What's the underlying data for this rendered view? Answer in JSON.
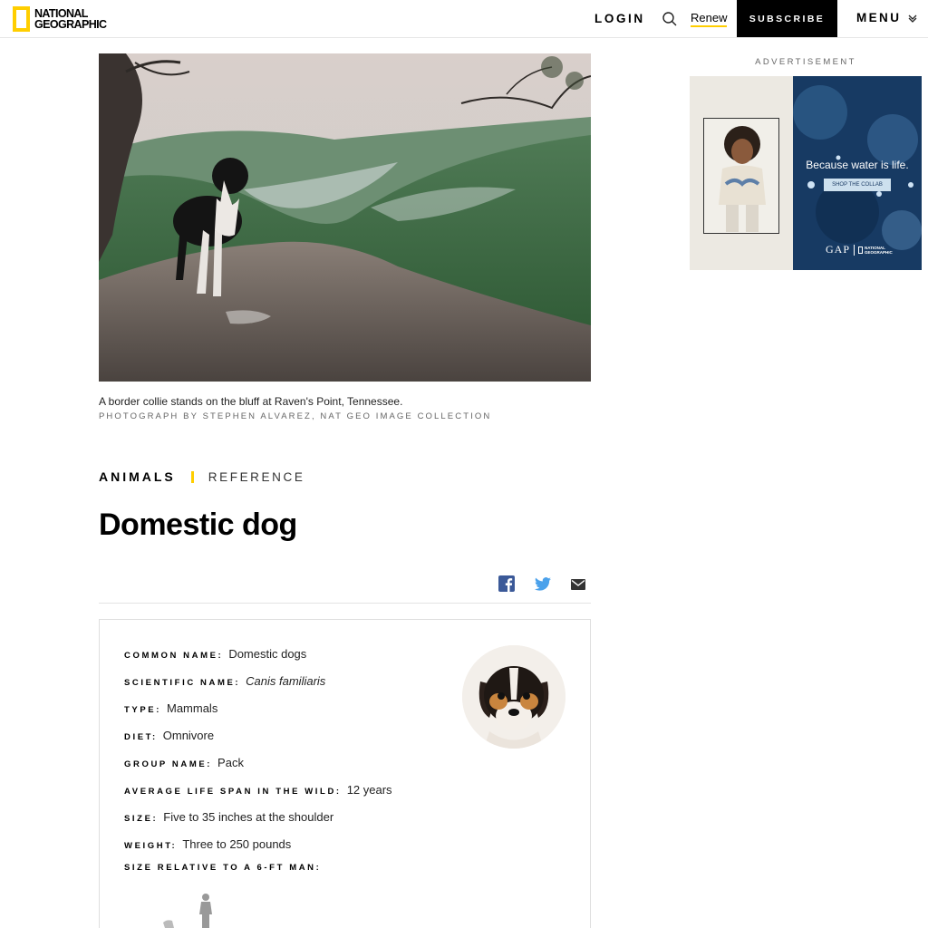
{
  "header": {
    "logo_line1": "NATIONAL",
    "logo_line2": "GEOGRAPHIC",
    "login_label": "LOGIN",
    "search_icon": "search-icon",
    "renew_label": "Renew",
    "subscribe_label": "SUBSCRIBE",
    "menu_label": "MENU",
    "accent_color": "#ffce00"
  },
  "hero": {
    "caption": "A border collie stands on the bluff at Raven's Point, Tennessee.",
    "credit": "PHOTOGRAPH BY STEPHEN ALVAREZ, NAT GEO IMAGE COLLECTION"
  },
  "ad": {
    "label": "ADVERTISEMENT",
    "headline": "Because water is life.",
    "cta": "SHOP THE COLLAB",
    "brand1": "GAP",
    "brand2_line1": "NATIONAL",
    "brand2_line2": "GEOGRAPHIC"
  },
  "article": {
    "category": "ANIMALS",
    "subcategory": "REFERENCE",
    "title": "Domestic dog",
    "share_icons": [
      "facebook-icon",
      "twitter-icon",
      "email-icon"
    ]
  },
  "facts": {
    "common_name_label": "COMMON NAME:",
    "common_name": "Domestic dogs",
    "scientific_name_label": "SCIENTIFIC NAME:",
    "scientific_name": "Canis familiaris",
    "type_label": "TYPE:",
    "type": "Mammals",
    "diet_label": "DIET:",
    "diet": "Omnivore",
    "group_name_label": "GROUP NAME:",
    "group_name": "Pack",
    "life_span_label": "AVERAGE LIFE SPAN IN THE WILD:",
    "life_span": "12 years",
    "size_label": "SIZE:",
    "size": "Five to 35 inches at the shoulder",
    "weight_label": "WEIGHT:",
    "weight": "Three to 250 pounds",
    "relative_label": "SIZE RELATIVE TO A 6-FT MAN:"
  }
}
